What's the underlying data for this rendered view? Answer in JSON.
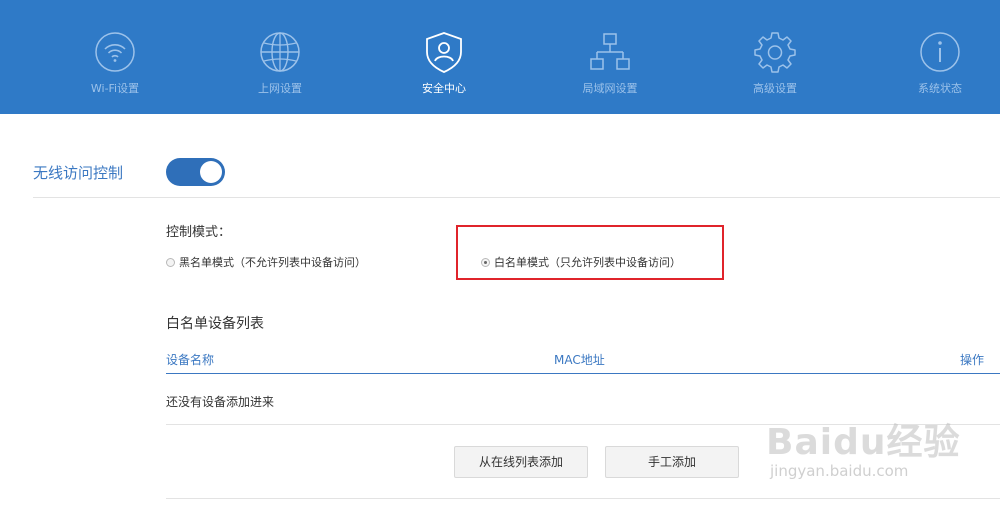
{
  "nav": {
    "items": [
      {
        "label": "Wi-Fi设置",
        "icon": "wifi-icon"
      },
      {
        "label": "上网设置",
        "icon": "globe-icon"
      },
      {
        "label": "安全中心",
        "icon": "shield-user-icon",
        "active": true
      },
      {
        "label": "局域网设置",
        "icon": "network-icon"
      },
      {
        "label": "高级设置",
        "icon": "gear-icon"
      },
      {
        "label": "系统状态",
        "icon": "info-icon"
      }
    ]
  },
  "section": {
    "title": "无线访问控制",
    "toggle_on": true
  },
  "mode": {
    "label": "控制模式：",
    "options": [
      {
        "label": "黑名单模式（不允许列表中设备访问）",
        "checked": false
      },
      {
        "label": "白名单模式（只允许列表中设备访问）",
        "checked": true
      }
    ]
  },
  "list": {
    "title": "白名单设备列表",
    "columns": [
      "设备名称",
      "MAC地址",
      "操作"
    ],
    "empty_text": "还没有设备添加进来"
  },
  "buttons": {
    "add_from_online": "从在线列表添加",
    "add_manual": "手工添加"
  },
  "watermark": {
    "main": "Baidu经验",
    "sub": "jingyan.baidu.com"
  },
  "colors": {
    "nav_bg": "#2f7ac7",
    "accent": "#3b78c2",
    "highlight": "#e0242b"
  }
}
